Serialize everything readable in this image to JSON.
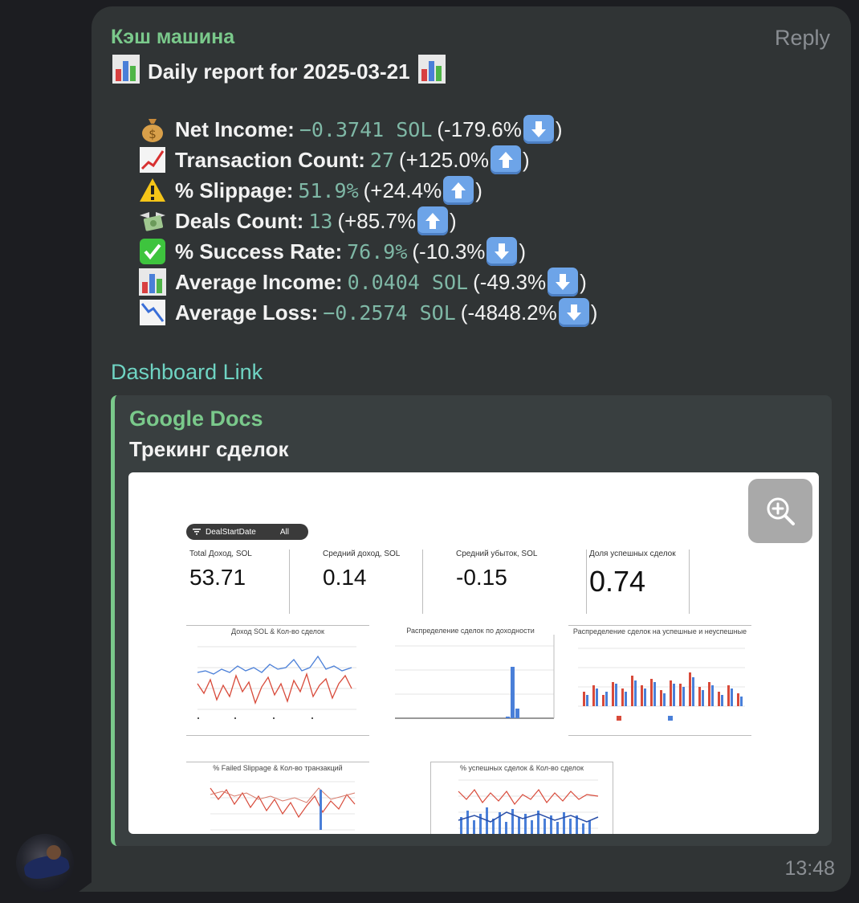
{
  "message": {
    "sender": "Кэш машина",
    "reply_label": "Reply",
    "title": "Daily report for 2025-03-21",
    "time": "13:48",
    "metrics": [
      {
        "icon": "money-bag-icon",
        "label": "Net Income:",
        "value": "−0.3741 SOL",
        "change": "(-179.6%",
        "direction": "down"
      },
      {
        "icon": "chart-up-icon",
        "label": "Transaction Count:",
        "value": "27",
        "change": "(+125.0%",
        "direction": "up"
      },
      {
        "icon": "warning-icon",
        "label": "% Slippage:",
        "value": "51.9%",
        "change": "(+24.4%",
        "direction": "up"
      },
      {
        "icon": "money-wings-icon",
        "label": "Deals Count:",
        "value": "13",
        "change": "(+85.7%",
        "direction": "up"
      },
      {
        "icon": "check-mark-icon",
        "label": "% Success Rate:",
        "value": "76.9%",
        "change": "(-10.3%",
        "direction": "down"
      },
      {
        "icon": "bar-chart-icon",
        "label": "Average Income:",
        "value": "0.0404 SOL",
        "change": "(-49.3%",
        "direction": "down"
      },
      {
        "icon": "chart-down-icon",
        "label": "Average Loss:",
        "value": "−0.2574 SOL",
        "change": "(-4848.2%",
        "direction": "down"
      }
    ],
    "close_paren": ")",
    "link_text": "Dashboard Link",
    "preview": {
      "site": "Google Docs",
      "title": "Трекинг сделок",
      "dashboard": {
        "filter_name": "DealStartDate",
        "filter_value": "All",
        "kpis": [
          {
            "label": "Total Доход, SOL",
            "value": "53.71"
          },
          {
            "label": "Средний доход, SOL",
            "value": "0.14"
          },
          {
            "label": "Средний убыток, SOL",
            "value": "-0.15"
          },
          {
            "label": "Доля успешных сделок",
            "value": "0.74"
          }
        ],
        "charts": [
          "Доход SOL & Кол-во сделок",
          "Распределение сделок по доходности",
          "Распределение сделок на успешные и неуспешные",
          "% Failed Slippage & Кол-во транзакций",
          "% успешных сделок & Кол-во сделок"
        ]
      }
    }
  }
}
